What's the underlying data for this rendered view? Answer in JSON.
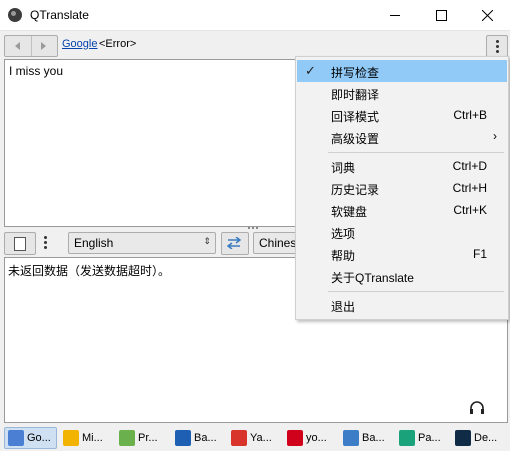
{
  "window": {
    "title": "QTranslate"
  },
  "toolbar": {
    "service_link": "Google",
    "status": "<Error>"
  },
  "source": {
    "text": "I miss you"
  },
  "language": {
    "from": "English",
    "to": "Chinese"
  },
  "result": {
    "text": "未返回数据（发送数据超时）。"
  },
  "menu": {
    "items": [
      {
        "label": "拼写检查",
        "checked": true
      },
      {
        "label": "即时翻译"
      },
      {
        "label": "回译模式",
        "shortcut": "Ctrl+B"
      },
      {
        "label": "高级设置",
        "submenu": true
      },
      {
        "label": "词典",
        "shortcut": "Ctrl+D"
      },
      {
        "label": "历史记录",
        "shortcut": "Ctrl+H"
      },
      {
        "label": "软键盘",
        "shortcut": "Ctrl+K"
      },
      {
        "label": "选项"
      },
      {
        "label": "帮助",
        "shortcut": "F1"
      },
      {
        "label": "关于QTranslate"
      },
      {
        "label": "退出"
      }
    ]
  },
  "services": [
    {
      "label": "Go...",
      "color": "#4a7fd4",
      "icon": "google-icon"
    },
    {
      "label": "Mi...",
      "color": "#f2b400",
      "icon": "bing-icon"
    },
    {
      "label": "Pr...",
      "color": "#6ab04c",
      "icon": "promt-icon"
    },
    {
      "label": "Ba...",
      "color": "#1e5fb4",
      "icon": "babylon-icon"
    },
    {
      "label": "Ya...",
      "color": "#d9342b",
      "icon": "yandex-icon"
    },
    {
      "label": "yo...",
      "color": "#d0021b",
      "icon": "youdao-icon"
    },
    {
      "label": "Ba...",
      "color": "#3d7dc8",
      "icon": "baidu-icon"
    },
    {
      "label": "Pa...",
      "color": "#1aa37a",
      "icon": "papago-icon"
    },
    {
      "label": "De...",
      "color": "#0f2b46",
      "icon": "deepl-icon"
    }
  ],
  "colors": {
    "menu_highlight": "#91c9f7",
    "link": "#0645ad",
    "active_tab": "#cfe0f3"
  }
}
